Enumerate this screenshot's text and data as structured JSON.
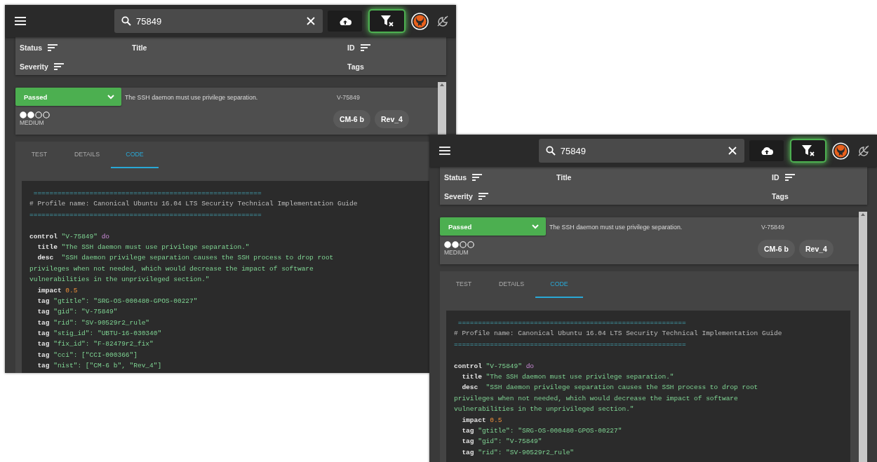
{
  "windows": [
    {
      "search": {
        "value": "75849"
      },
      "filter_button": {
        "active": true
      },
      "columns": [
        {
          "label": "Status",
          "sortable": true
        },
        {
          "label": "Title",
          "sortable": false
        },
        {
          "label": "ID",
          "sortable": true
        }
      ],
      "columns_row_2": [
        {
          "label": "Severity",
          "sortable": true
        },
        {
          "label": "Tags",
          "sortable": false
        }
      ],
      "result": {
        "status": "Passed",
        "title": "The SSH daemon must use privilege separation.",
        "id": "V-75849",
        "severity": {
          "stars": 2,
          "label": "MEDIUM"
        },
        "tags": [
          "CM-6 b",
          "Rev_4"
        ]
      },
      "tabs": [
        {
          "label": "TEST",
          "selected": false
        },
        {
          "label": "DETAILS",
          "selected": false
        },
        {
          "label": "CODE",
          "selected": true
        }
      ],
      "code_header": [
        [
          {
            "kind": "rule",
            "text": " ========================================================="
          }
        ],
        [
          {
            "kind": "comment",
            "text": "# Profile name: Canonical Ubuntu 16.04 LTS Security Technical Implementation Guide"
          }
        ],
        [
          {
            "kind": "rule",
            "text": "=========================================================="
          }
        ]
      ],
      "code_body": [
        [
          {
            "kind": "keyword",
            "text": "control"
          },
          {
            "kind": "string",
            "text": " \"V-75849\""
          },
          {
            "kind": "do",
            "text": " do"
          }
        ],
        [
          {
            "kind": "keyword",
            "text": "  title"
          },
          {
            "kind": "string",
            "text": " \"The SSH daemon must use privilege separation.\""
          }
        ],
        [
          {
            "kind": "keyword",
            "text": "  desc"
          },
          {
            "kind": "string",
            "text": "  \"SSH daemon privilege separation causes the SSH process to drop root"
          }
        ],
        [
          {
            "kind": "string",
            "text": "privileges when not needed, which would decrease the impact of software"
          }
        ],
        [
          {
            "kind": "string",
            "text": "vulnerabilities in the unprivileged section.\""
          }
        ],
        [
          {
            "kind": "keyword",
            "text": "  impact"
          },
          {
            "kind": "number",
            "text": " 0.5"
          }
        ],
        [
          {
            "kind": "keyword",
            "text": "  tag"
          },
          {
            "kind": "string",
            "text": " \"gtitle\": \"SRG-OS-000480-GPOS-00227\""
          }
        ],
        [
          {
            "kind": "keyword",
            "text": "  tag"
          },
          {
            "kind": "string",
            "text": " \"gid\": \"V-75849\""
          }
        ],
        [
          {
            "kind": "keyword",
            "text": "  tag"
          },
          {
            "kind": "string",
            "text": " \"rid\": \"SV-90529r2_rule\""
          }
        ],
        [
          {
            "kind": "keyword",
            "text": "  tag"
          },
          {
            "kind": "string",
            "text": " \"stig_id\": \"UBTU-16-030340\""
          }
        ],
        [
          {
            "kind": "keyword",
            "text": "  tag"
          },
          {
            "kind": "string",
            "text": " \"fix_id\": \"F-82479r2_fix\""
          }
        ],
        [
          {
            "kind": "keyword",
            "text": "  tag"
          },
          {
            "kind": "string",
            "text": " \"cci\": [\"CCI-000366\"]"
          }
        ],
        [
          {
            "kind": "keyword",
            "text": "  tag"
          },
          {
            "kind": "string",
            "text": " \"nist\": [\"CM-6 b\", \"Rev_4\"]"
          }
        ]
      ]
    },
    {
      "search": {
        "value": "75849"
      },
      "filter_button": {
        "active": true
      },
      "columns": [
        {
          "label": "Status",
          "sortable": true
        },
        {
          "label": "Title",
          "sortable": false
        },
        {
          "label": "ID",
          "sortable": true
        }
      ],
      "columns_row_2": [
        {
          "label": "Severity",
          "sortable": true
        },
        {
          "label": "Tags",
          "sortable": false
        }
      ],
      "result": {
        "status": "Passed",
        "title": "The SSH daemon must use privilege separation.",
        "id": "V-75849",
        "severity": {
          "stars": 2,
          "label": "MEDIUM"
        },
        "tags": [
          "CM-6 b",
          "Rev_4"
        ]
      },
      "tabs": [
        {
          "label": "TEST",
          "selected": false
        },
        {
          "label": "DETAILS",
          "selected": false
        },
        {
          "label": "CODE",
          "selected": true
        }
      ],
      "code_header": [
        [
          {
            "kind": "rule",
            "text": " ========================================================="
          }
        ],
        [
          {
            "kind": "comment",
            "text": "# Profile name: Canonical Ubuntu 16.04 LTS Security Technical Implementation Guide"
          }
        ],
        [
          {
            "kind": "rule",
            "text": "=========================================================="
          }
        ]
      ],
      "code_body": [
        [
          {
            "kind": "keyword",
            "text": "control"
          },
          {
            "kind": "string",
            "text": " \"V-75849\""
          },
          {
            "kind": "do",
            "text": " do"
          }
        ],
        [
          {
            "kind": "keyword",
            "text": "  title"
          },
          {
            "kind": "string",
            "text": " \"The SSH daemon must use privilege separation.\""
          }
        ],
        [
          {
            "kind": "keyword",
            "text": "  desc"
          },
          {
            "kind": "string",
            "text": "  \"SSH daemon privilege separation causes the SSH process to drop root"
          }
        ],
        [
          {
            "kind": "string",
            "text": "privileges when not needed, which would decrease the impact of software"
          }
        ],
        [
          {
            "kind": "string",
            "text": "vulnerabilities in the unprivileged section.\""
          }
        ],
        [
          {
            "kind": "keyword",
            "text": "  impact"
          },
          {
            "kind": "number",
            "text": " 0.5"
          }
        ],
        [
          {
            "kind": "keyword",
            "text": "  tag"
          },
          {
            "kind": "string",
            "text": " \"gtitle\": \"SRG-OS-000480-GPOS-00227\""
          }
        ],
        [
          {
            "kind": "keyword",
            "text": "  tag"
          },
          {
            "kind": "string",
            "text": " \"gid\": \"V-75849\""
          }
        ],
        [
          {
            "kind": "keyword",
            "text": "  tag"
          },
          {
            "kind": "string",
            "text": " \"rid\": \"SV-90529r2_rule\""
          }
        ]
      ]
    }
  ]
}
